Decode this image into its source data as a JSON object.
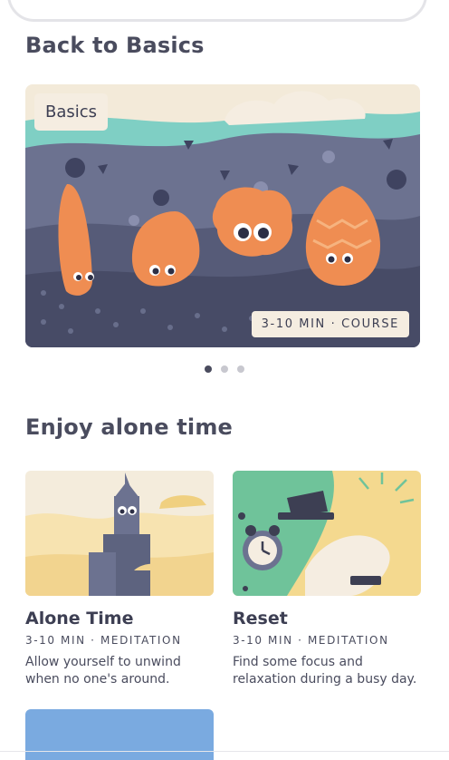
{
  "sections": {
    "featured_title": "Back to Basics",
    "alone_title": "Enjoy alone time"
  },
  "hero": {
    "tag": "Basics",
    "meta": "3-10 MIN · COURSE",
    "carousel_pages": 3,
    "active_page": 1
  },
  "cards": [
    {
      "title": "Alone Time",
      "meta": "3-10 MIN · MEDITATION",
      "description": "Allow yourself to unwind when no one's around."
    },
    {
      "title": "Reset",
      "meta": "3-10 MIN · MEDITATION",
      "description": "Find some focus and relaxation during a busy day."
    }
  ],
  "colors": {
    "accent_orange": "#ef8d52",
    "slate": "#6c7290",
    "teal": "#7fcfc4",
    "cream": "#f5ede1",
    "blue_card": "#7aaae0"
  }
}
